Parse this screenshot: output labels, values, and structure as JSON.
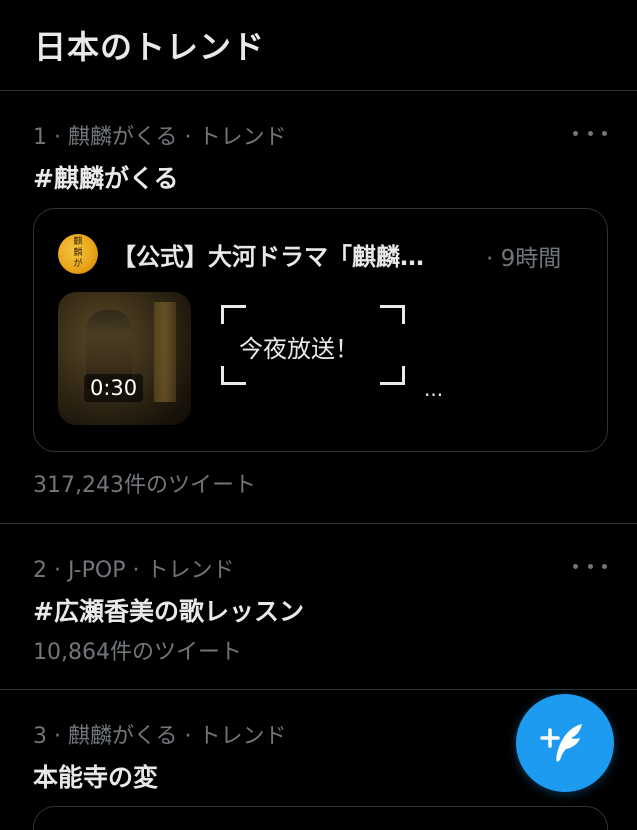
{
  "header": {
    "title": "日本のトレンド"
  },
  "trends": [
    {
      "meta": "1 · 麒麟がくる · トレンド",
      "name": "#麒麟がくる",
      "count": "317,243件のツイート",
      "card": {
        "author": "【公式】大河ドラマ「麒麟…",
        "time": "· 9時間",
        "video_duration": "0:30",
        "text": "今夜放送！",
        "ellipsis": "..."
      }
    },
    {
      "meta": "2 · J-POP · トレンド",
      "name": "#広瀬香美の歌レッスン",
      "count": "10,864件のツイート"
    },
    {
      "meta": "3 · 麒麟がくる · トレンド",
      "name": "本能寺の変"
    }
  ],
  "icons": {
    "more": "more-dots-icon",
    "compose": "compose-tweet-icon"
  },
  "colors": {
    "background": "#000000",
    "primary_text": "#e7e9ea",
    "secondary_text": "#71767b",
    "accent": "#1d9bf0",
    "divider": "#2f3336"
  }
}
